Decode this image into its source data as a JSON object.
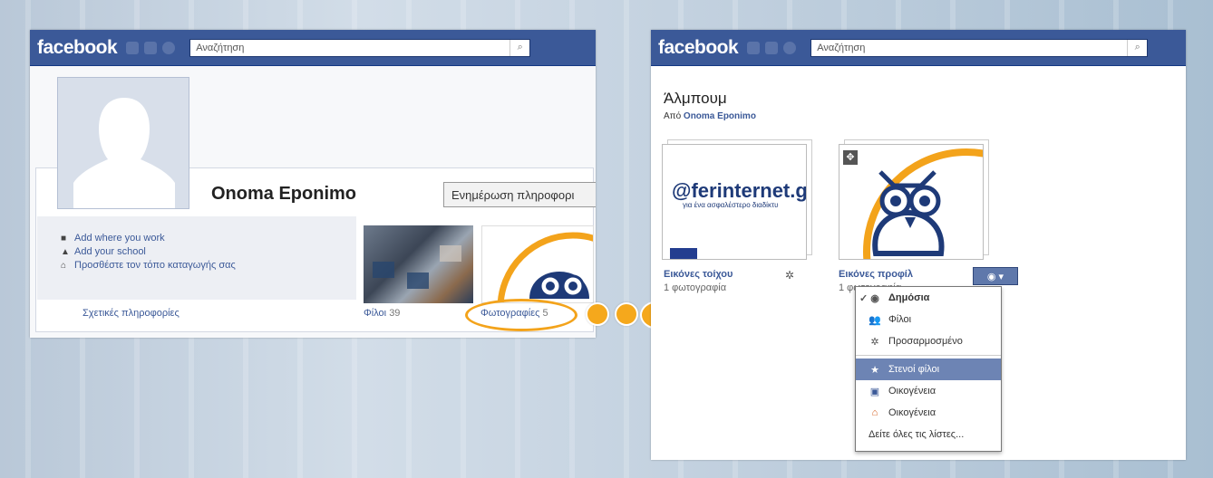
{
  "left": {
    "logo": "facebook",
    "search_placeholder": "Αναζήτηση",
    "profile_name": "Onoma Eponimo",
    "update_button": "Ενημέρωση πληροφορι",
    "info_items": [
      "Add where you work",
      "Add your school",
      "Προσθέστε τον τόπο καταγωγής σας"
    ],
    "about_link": "Σχετικές πληροφορίες",
    "friends_label": "Φίλοι",
    "friends_count": "39",
    "photos_label": "Φωτογραφίες",
    "photos_count": "5"
  },
  "right": {
    "logo": "facebook",
    "search_placeholder": "Αναζήτηση",
    "page_title": "Άλμπουμ",
    "by_prefix": "Από",
    "by_name": "Onoma Eponimo",
    "albums": [
      {
        "title": "Εικόνες τοίχου",
        "count": "1 φωτογραφία"
      },
      {
        "title": "Εικόνες προφίλ",
        "count": "1 φωτογραφία"
      }
    ],
    "album1_logo": "@ferinternet.g",
    "album1_sub": "για ένα ασφαλέστερο διαδίκτυ",
    "privacy_menu": [
      {
        "label": "Δημόσια",
        "icon": "globe-icon",
        "checked": true
      },
      {
        "label": "Φίλοι",
        "icon": "friends-icon"
      },
      {
        "label": "Προσαρμοσμένο",
        "icon": "gear-icon"
      },
      {
        "label": "Στενοί φίλοι",
        "icon": "star-icon",
        "highlighted": true
      },
      {
        "label": "Οικογένεια",
        "icon": "family-icon"
      },
      {
        "label": "Οικογένεια",
        "icon": "home-icon"
      },
      {
        "label": "Δείτε όλες τις λίστες..."
      }
    ]
  },
  "colors": {
    "facebook_blue": "#3b5998",
    "accent_orange": "#f5a81c"
  }
}
